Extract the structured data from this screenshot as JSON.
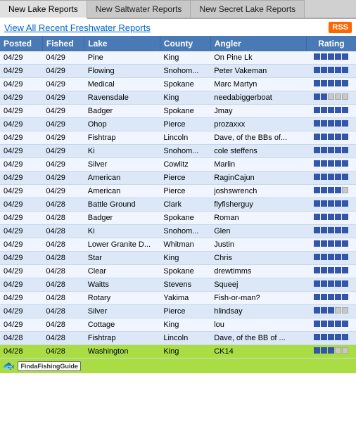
{
  "tabs": [
    {
      "label": "New Lake Reports",
      "active": true
    },
    {
      "label": "New Saltwater Reports",
      "active": false
    },
    {
      "label": "New Secret Lake Reports",
      "active": false
    }
  ],
  "header": {
    "link_text": "View All Recent Freshwater Reports",
    "rss_label": "RSS"
  },
  "table": {
    "columns": [
      "Posted",
      "Fished",
      "Lake",
      "County",
      "Angler",
      "Rating"
    ],
    "rows": [
      {
        "posted": "04/29",
        "fished": "04/29",
        "lake": "Pine",
        "county": "King",
        "angler": "On Pine Lk",
        "rating": [
          5,
          0
        ]
      },
      {
        "posted": "04/29",
        "fished": "04/29",
        "lake": "Flowing",
        "county": "Snohom...",
        "angler": "Peter Vakeman",
        "rating": [
          5,
          0
        ]
      },
      {
        "posted": "04/29",
        "fished": "04/29",
        "lake": "Medical",
        "county": "Spokane",
        "angler": "Marc Martyn",
        "rating": [
          5,
          0
        ]
      },
      {
        "posted": "04/29",
        "fished": "04/29",
        "lake": "Ravensdale",
        "county": "King",
        "angler": "needabiggerboat",
        "rating": [
          2,
          3
        ]
      },
      {
        "posted": "04/29",
        "fished": "04/29",
        "lake": "Badger",
        "county": "Spokane",
        "angler": "Jmay",
        "rating": [
          5,
          0
        ]
      },
      {
        "posted": "04/29",
        "fished": "04/29",
        "lake": "Ohop",
        "county": "Pierce",
        "angler": "prozaxxx",
        "rating": [
          5,
          0
        ]
      },
      {
        "posted": "04/29",
        "fished": "04/29",
        "lake": "Fishtrap",
        "county": "Lincoln",
        "angler": "Dave, of the BBs of...",
        "rating": [
          5,
          0
        ]
      },
      {
        "posted": "04/29",
        "fished": "04/29",
        "lake": "Ki",
        "county": "Snohom...",
        "angler": "cole steffens",
        "rating": [
          5,
          0
        ]
      },
      {
        "posted": "04/29",
        "fished": "04/29",
        "lake": "Silver",
        "county": "Cowlitz",
        "angler": "Marlin",
        "rating": [
          5,
          0
        ]
      },
      {
        "posted": "04/29",
        "fished": "04/29",
        "lake": "American",
        "county": "Pierce",
        "angler": "RaginCajun",
        "rating": [
          5,
          0
        ]
      },
      {
        "posted": "04/29",
        "fished": "04/29",
        "lake": "American",
        "county": "Pierce",
        "angler": "joshswrench",
        "rating": [
          4,
          1
        ]
      },
      {
        "posted": "04/29",
        "fished": "04/28",
        "lake": "Battle Ground",
        "county": "Clark",
        "angler": "flyfisherguy",
        "rating": [
          5,
          0
        ]
      },
      {
        "posted": "04/29",
        "fished": "04/28",
        "lake": "Badger",
        "county": "Spokane",
        "angler": "Roman",
        "rating": [
          5,
          0
        ]
      },
      {
        "posted": "04/29",
        "fished": "04/28",
        "lake": "Ki",
        "county": "Snohom...",
        "angler": "Glen",
        "rating": [
          5,
          0
        ]
      },
      {
        "posted": "04/29",
        "fished": "04/28",
        "lake": "Lower Granite D...",
        "county": "Whitman",
        "angler": "Justin",
        "rating": [
          5,
          0
        ]
      },
      {
        "posted": "04/29",
        "fished": "04/28",
        "lake": "Star",
        "county": "King",
        "angler": "Chris",
        "rating": [
          5,
          0
        ]
      },
      {
        "posted": "04/29",
        "fished": "04/28",
        "lake": "Clear",
        "county": "Spokane",
        "angler": "drewtimms",
        "rating": [
          5,
          0
        ]
      },
      {
        "posted": "04/29",
        "fished": "04/28",
        "lake": "Waitts",
        "county": "Stevens",
        "angler": "Squeej",
        "rating": [
          5,
          0
        ]
      },
      {
        "posted": "04/29",
        "fished": "04/28",
        "lake": "Rotary",
        "county": "Yakima",
        "angler": "Fish-or-man?",
        "rating": [
          5,
          0
        ]
      },
      {
        "posted": "04/29",
        "fished": "04/28",
        "lake": "Silver",
        "county": "Pierce",
        "angler": "hlindsay",
        "rating": [
          3,
          2
        ]
      },
      {
        "posted": "04/29",
        "fished": "04/28",
        "lake": "Cottage",
        "county": "King",
        "angler": "lou",
        "rating": [
          5,
          0
        ]
      },
      {
        "posted": "04/28",
        "fished": "04/28",
        "lake": "Fishtrap",
        "county": "Lincoln",
        "angler": "Dave, of the BB of ...",
        "rating": [
          5,
          0
        ]
      },
      {
        "posted": "04/28",
        "fished": "04/28",
        "lake": "Washington",
        "county": "King",
        "angler": "CK14",
        "rating": [
          3,
          2
        ],
        "highlighted": true
      }
    ]
  },
  "banner": {
    "logo_text": "FindaFishingGuide",
    "fish_char": "🐟"
  }
}
